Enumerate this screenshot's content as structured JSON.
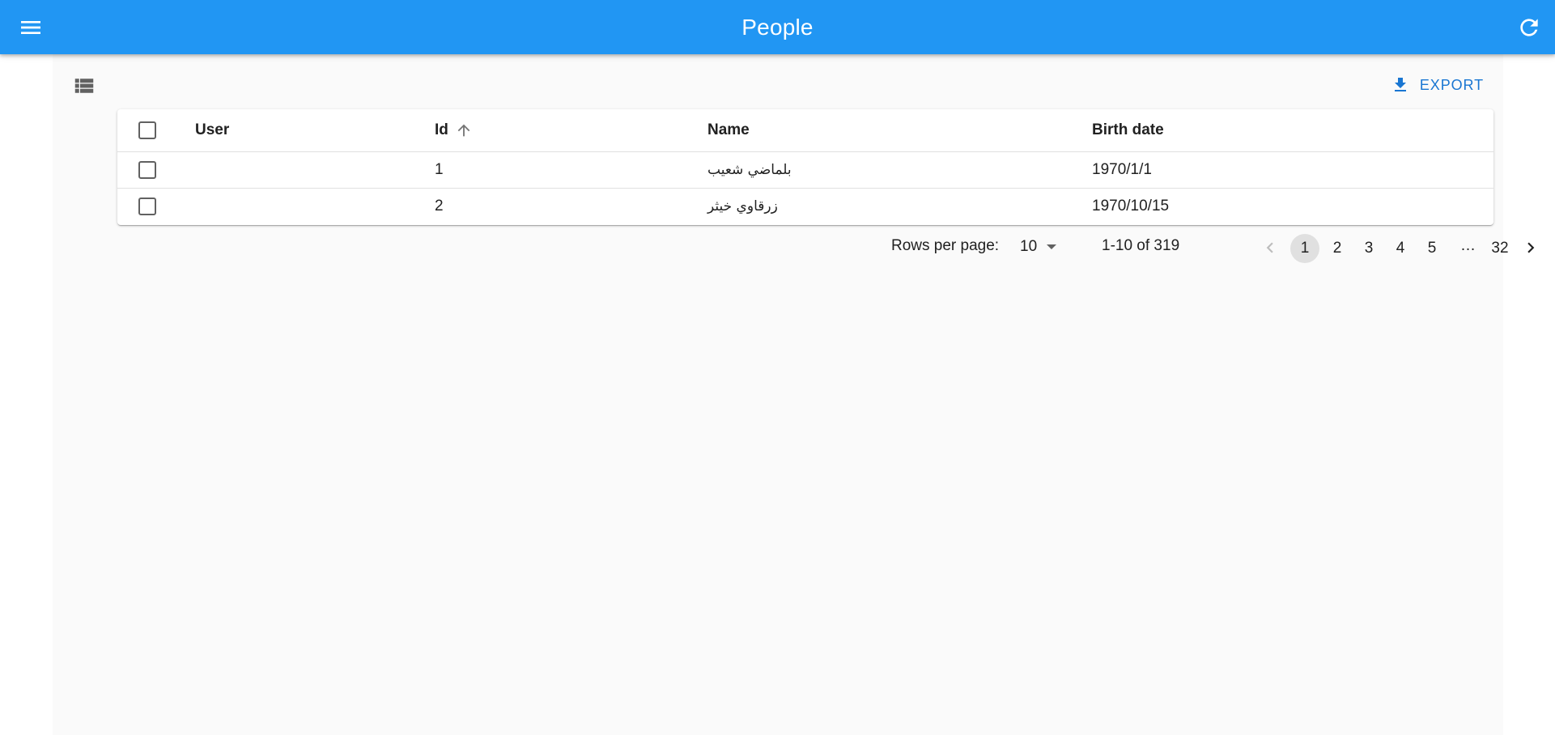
{
  "appbar": {
    "title": "People",
    "menu_icon": "menu-icon",
    "refresh_icon": "refresh-icon",
    "color": "#2196f3"
  },
  "toolbar": {
    "list_icon": "view-list-icon",
    "export_label": "EXPORT",
    "export_icon": "download-icon",
    "accent": "#1976d2"
  },
  "table": {
    "columns": {
      "user": "User",
      "id": "Id",
      "name": "Name",
      "birth_date": "Birth date"
    },
    "sort": {
      "column": "Id",
      "direction": "ascending",
      "icon": "arrow-up-icon"
    },
    "rows": [
      {
        "user": "",
        "id": "1",
        "name": "بلماضي شعيب",
        "birth_date": "1970/1/1"
      },
      {
        "user": "",
        "id": "2",
        "name": "زرقاوي خيثر",
        "birth_date": "1970/10/15"
      }
    ]
  },
  "pagination": {
    "rows_per_page_label": "Rows per page:",
    "rows_per_page_value": "10",
    "range": "1-10 of 319",
    "pages": [
      "1",
      "2",
      "3",
      "4",
      "5"
    ],
    "ellipsis": "…",
    "last_page": "32",
    "current_page": "1"
  }
}
